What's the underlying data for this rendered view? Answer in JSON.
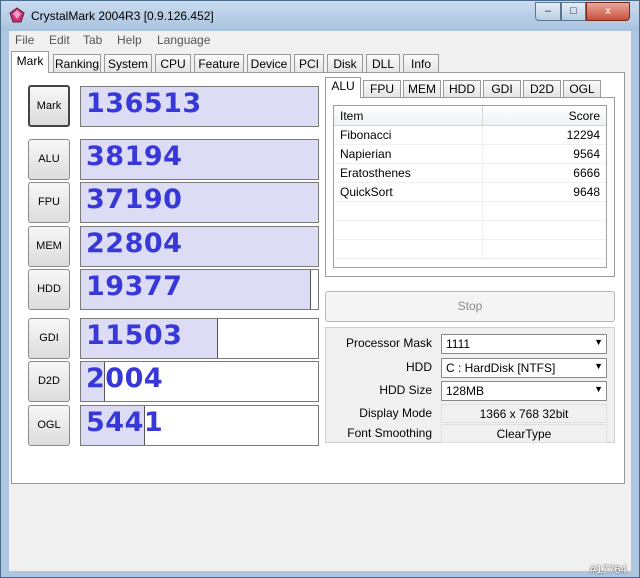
{
  "window": {
    "title": "CrystalMark 2004R3 [0.9.126.452]",
    "controls": {
      "minimize": "–",
      "maximize": "□",
      "close": "x"
    }
  },
  "menu": [
    "File",
    "Edit",
    "Tab",
    "Help",
    "Language"
  ],
  "main_tabs": [
    "Mark",
    "Ranking",
    "System",
    "CPU",
    "Feature",
    "Device",
    "PCI",
    "Disk",
    "DLL",
    "Info"
  ],
  "active_main_tab": "Mark",
  "scores": [
    {
      "label": "Mark",
      "value": "136513",
      "fill": 1.0
    },
    {
      "label": "ALU",
      "value": "38194",
      "fill": 1.0
    },
    {
      "label": "FPU",
      "value": "37190",
      "fill": 1.0
    },
    {
      "label": "MEM",
      "value": "22804",
      "fill": 1.0
    },
    {
      "label": "HDD",
      "value": "19377",
      "fill": 0.97
    },
    {
      "label": "GDI",
      "value": "11503",
      "fill": 0.58
    },
    {
      "label": "D2D",
      "value": "2004",
      "fill": 0.1
    },
    {
      "label": "OGL",
      "value": "5441",
      "fill": 0.27
    }
  ],
  "result_tabs": [
    "ALU",
    "FPU",
    "MEM",
    "HDD",
    "GDI",
    "D2D",
    "OGL"
  ],
  "active_result_tab": "ALU",
  "results_table": {
    "columns": [
      "Item",
      "Score"
    ],
    "rows": [
      {
        "item": "Fibonacci",
        "score": "12294"
      },
      {
        "item": "Napierian",
        "score": "9564"
      },
      {
        "item": "Eratosthenes",
        "score": "6666"
      },
      {
        "item": "QuickSort",
        "score": "9648"
      }
    ]
  },
  "stop_button": "Stop",
  "settings": {
    "processor_mask_label": "Processor Mask",
    "processor_mask_value": "1111",
    "hdd_label": "HDD",
    "hdd_value": "C : HardDisk [NTFS]",
    "hdd_size_label": "HDD Size",
    "hdd_size_value": "128MB",
    "display_mode_label": "Display Mode",
    "display_mode_value": "1366 x 768 32bit",
    "font_smoothing_label": "Font Smoothing",
    "font_smoothing_value": "ClearType"
  },
  "watermark": "#17764",
  "colors": {
    "score_text": "#3838d8",
    "score_fill": "#dcdcf4",
    "titlebar": "#aec6e0",
    "close_button": "#c9503c"
  }
}
